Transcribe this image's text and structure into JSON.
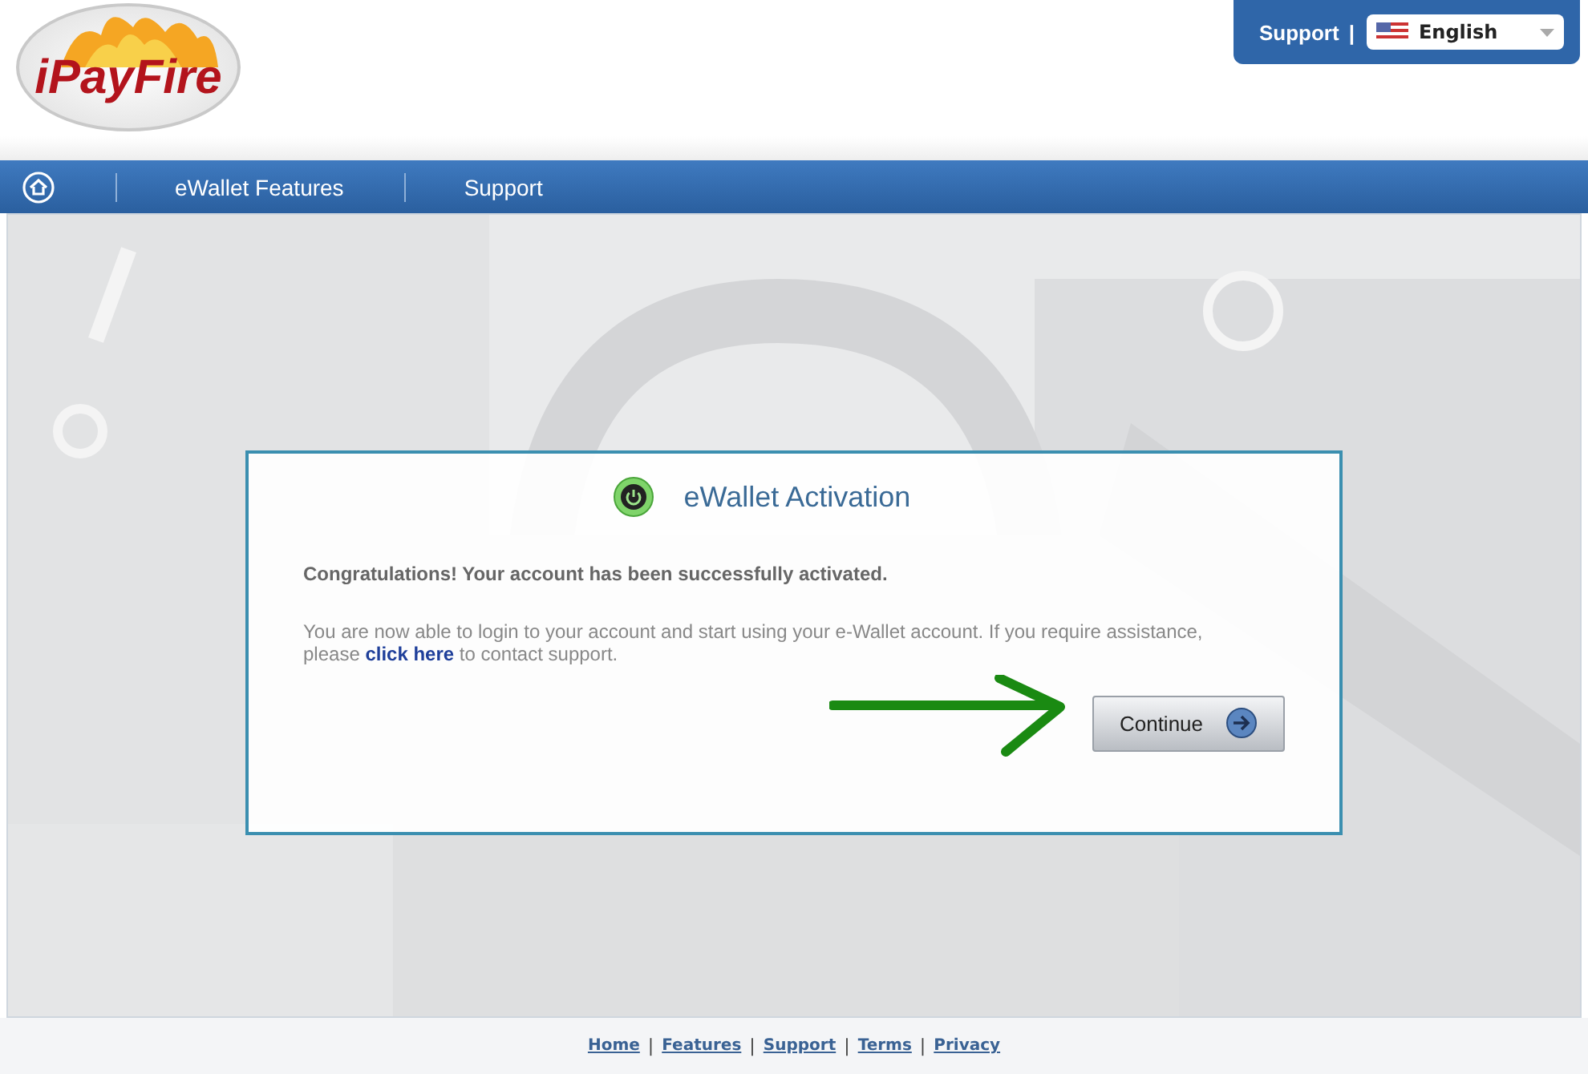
{
  "logo": {
    "text": "iPayFire"
  },
  "top_bar": {
    "support_link": "Support",
    "separator": "|",
    "language": {
      "value": "English"
    }
  },
  "nav": {
    "items": [
      {
        "label": "eWallet Features"
      },
      {
        "label": "Support"
      }
    ]
  },
  "card": {
    "title": "eWallet Activation",
    "headline": "Congratulations! Your account has been successfully activated.",
    "message": "You are now able to login to your account and start using your e-Wallet account. If you require assistance, please",
    "link": "click here",
    "message_end": "to contact support.",
    "button": "Continue"
  },
  "footer": {
    "links": [
      {
        "label": "Home"
      },
      {
        "label": "Features"
      },
      {
        "label": "Support"
      },
      {
        "label": "Terms"
      },
      {
        "label": "Privacy"
      }
    ],
    "separator": "|"
  }
}
